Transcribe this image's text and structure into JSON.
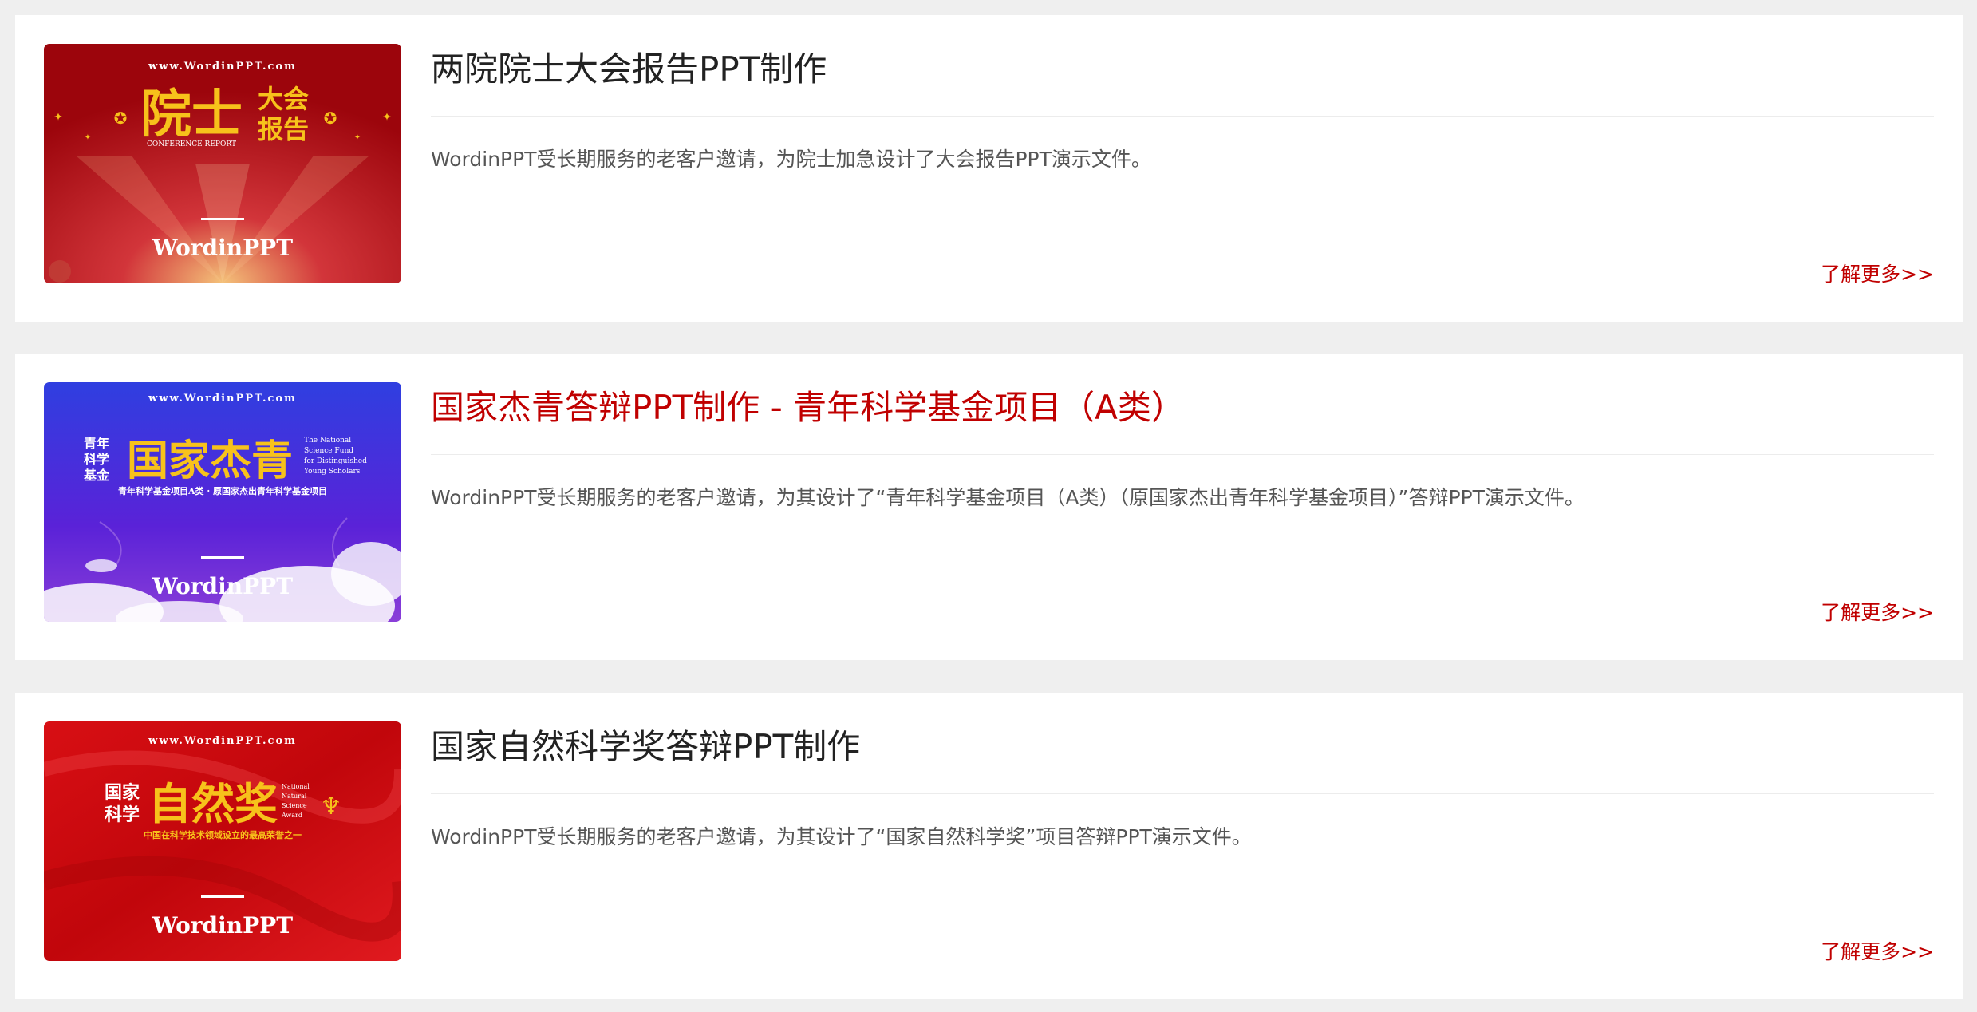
{
  "cards": [
    {
      "title": "两院院士大会报告PPT制作",
      "description": "WordinPPT受长期服务的老客户邀请，为院士加急设计了大会报告PPT演示文件。",
      "more_link": "了解更多>>",
      "thumb": {
        "url": "www.WordinPPT.com",
        "main_chars": "院士",
        "side_line1": "大会",
        "side_line2": "报告",
        "english": "CONFERENCE REPORT",
        "brand": "WordinPPT",
        "bg_color": "#b1070e",
        "accent_color": "#f7c21b"
      }
    },
    {
      "title": "国家杰青答辩PPT制作 - 青年科学基金项目（A类）",
      "description": "WordinPPT受长期服务的老客户邀请，为其设计了“青年科学基金项目（A类）（原国家杰出青年科学基金项目）”答辩PPT演示文件。",
      "more_link": "了解更多>>",
      "thumb": {
        "url": "www.WordinPPT.com",
        "side_line1": "青年",
        "side_line2": "科学",
        "side_line3": "基金",
        "main_chars": "国家杰青",
        "english_line1": "The National",
        "english_line2": "Science Fund",
        "english_line3": "for Distinguished",
        "english_line4": "Young Scholars",
        "subtitle": "青年科学基金项目A类 · 原国家杰出青年科学基金项目",
        "brand": "WordinPPT",
        "bg_color": "#4a1fd6",
        "accent_color": "#f7c21b"
      }
    },
    {
      "title": "国家自然科学奖答辩PPT制作",
      "description": "WordinPPT受长期服务的老客户邀请，为其设计了“国家自然科学奖”项目答辩PPT演示文件。",
      "more_link": "了解更多>>",
      "thumb": {
        "url": "www.WordinPPT.com",
        "side_line1": "国家",
        "side_line2": "科学",
        "main_chars": "自然奖",
        "english_line1": "National",
        "english_line2": "Natural",
        "english_line3": "Science",
        "english_line4": "Award",
        "subtitle": "中国在科学技术领域设立的最高荣誉之一",
        "brand": "WordinPPT",
        "bg_color": "#d40d12",
        "accent_color": "#f7c21b"
      }
    }
  ],
  "active_card_index": 1
}
